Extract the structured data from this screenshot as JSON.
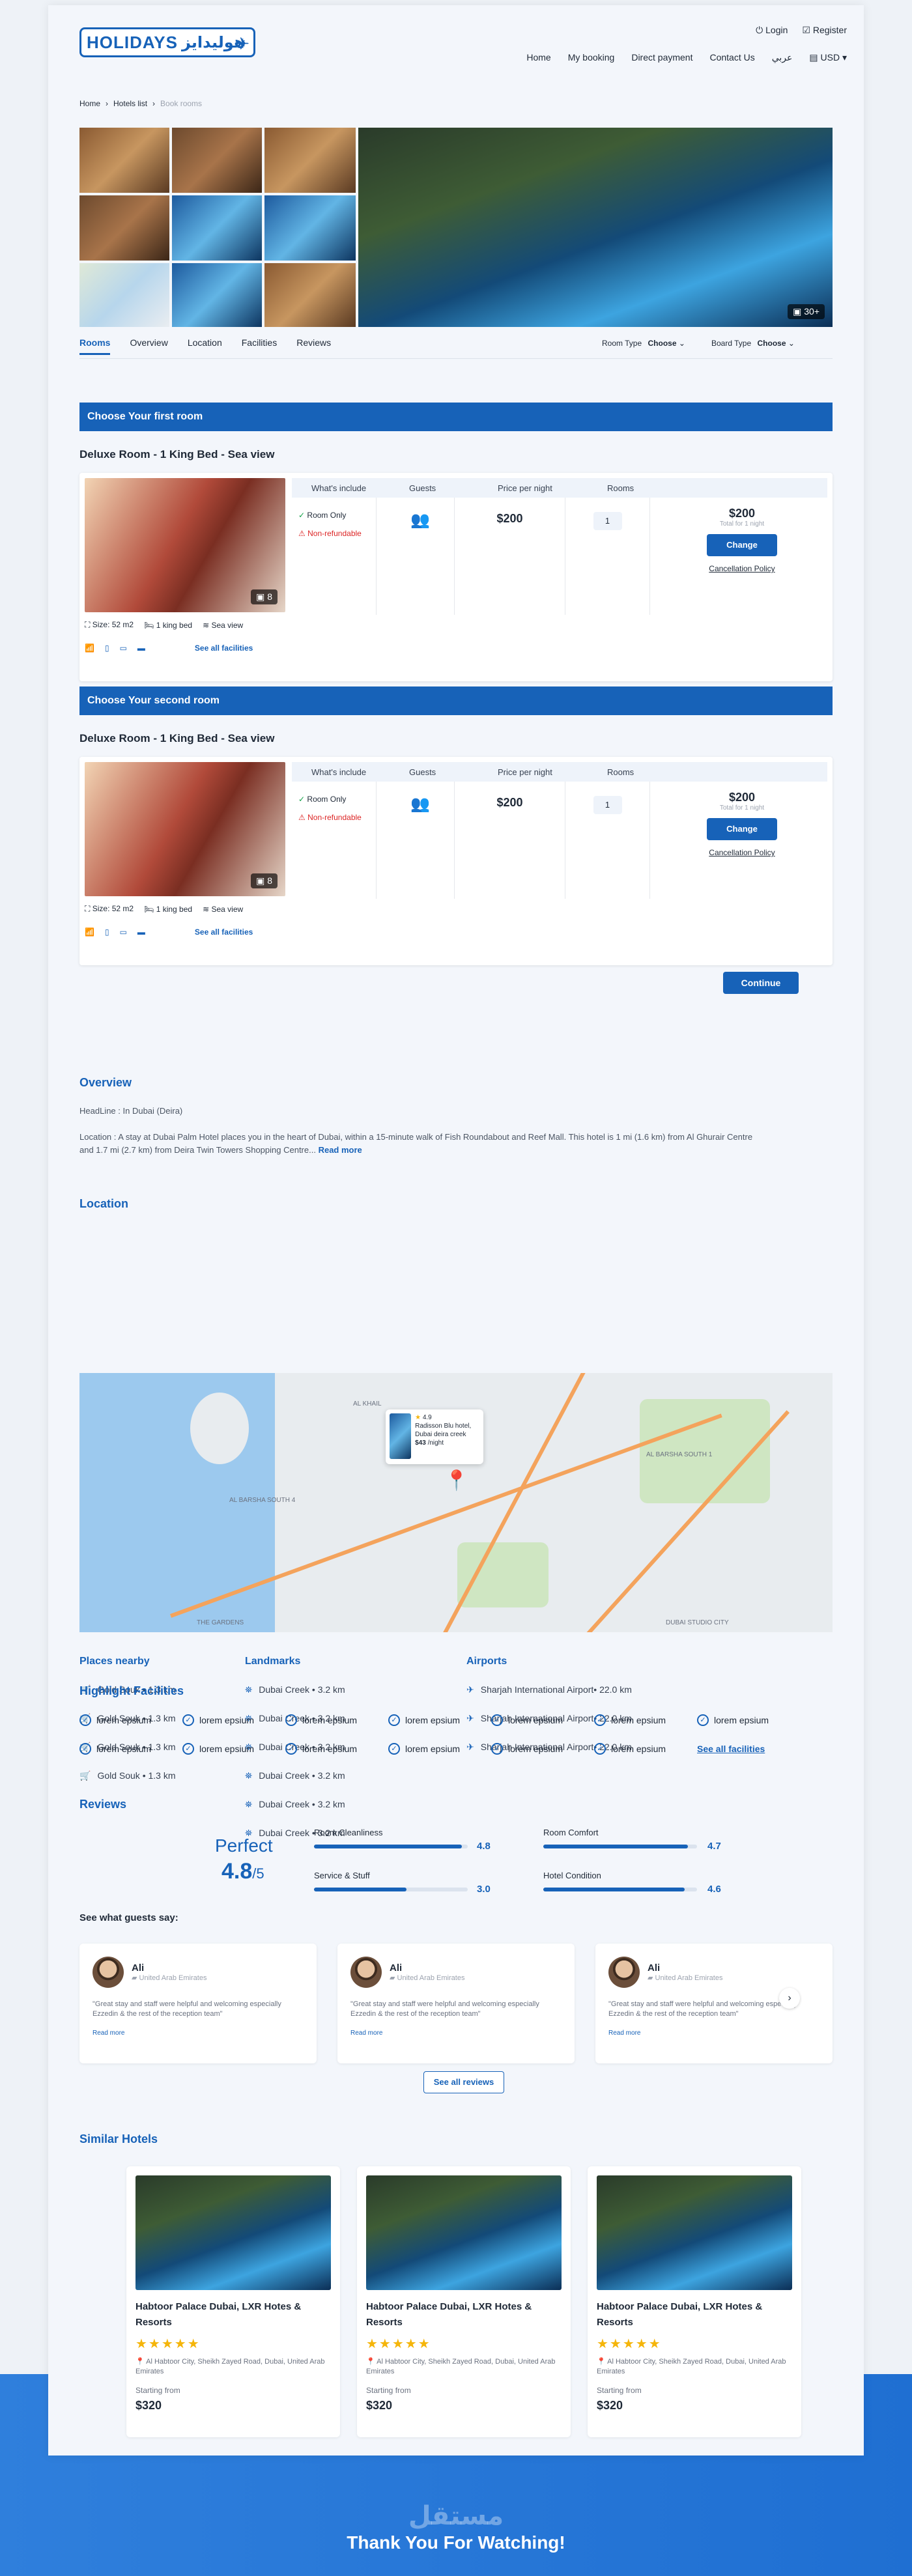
{
  "header": {
    "logo_text": "HOLIDAYS",
    "logo_arabic": "هوليدايز",
    "login": "Login",
    "register": "Register",
    "nav": [
      "Home",
      "My booking",
      "Direct payment",
      "Contact Us",
      "عربي"
    ],
    "currency": "USD"
  },
  "breadcrumb": [
    "Home",
    "Hotels list",
    "Book rooms"
  ],
  "gallery": {
    "count": "30+"
  },
  "tabs": [
    "Rooms",
    "Overview",
    "Location",
    "Facilities",
    "Reviews"
  ],
  "filters": {
    "room_type_label": "Room Type",
    "room_type_value": "Choose",
    "board_type_label": "Board Type",
    "board_type_value": "Choose"
  },
  "rooms": [
    {
      "section": "Choose Your first room",
      "title": "Deluxe Room - 1 King Bed - Sea view",
      "photos": "8",
      "headers": [
        "What's include",
        "Guests",
        "Price per night",
        "Rooms"
      ],
      "includes": [
        "Room Only",
        "Non-refundable"
      ],
      "price": "$200",
      "qty": "1",
      "total": "$200",
      "total_note": "Total for 1 night",
      "change": "Change",
      "policy": "Cancellation Policy",
      "size": "Size: 52 m2",
      "bed": "1 king bed",
      "view": "Sea view",
      "see_all": "See all facilities"
    },
    {
      "section": "Choose Your second room",
      "title": "Deluxe Room - 1 King Bed - Sea view",
      "photos": "8",
      "headers": [
        "What's include",
        "Guests",
        "Price per night",
        "Rooms"
      ],
      "includes": [
        "Room Only",
        "Non-refundable"
      ],
      "price": "$200",
      "qty": "1",
      "total": "$200",
      "total_note": "Total for 1 night",
      "change": "Change",
      "policy": "Cancellation Policy",
      "size": "Size: 52 m2",
      "bed": "1 king bed",
      "view": "Sea view",
      "see_all": "See all facilities"
    }
  ],
  "continue": "Continue",
  "overview": {
    "title": "Overview",
    "headline": "HeadLine : In Dubai (Deira)",
    "text": "Location : A stay at Dubai Palm Hotel places you in the heart of Dubai, within a 15-minute walk of Fish Roundabout and Reef Mall. This hotel is 1 mi (1.6 km) from Al Ghurair Centre and 1.7 mi (2.7 km) from Deira Twin Towers Shopping Centre...",
    "read_more": "Read more"
  },
  "location": {
    "title": "Location",
    "popup_rating": "4.9",
    "popup_name": "Radisson Blu hotel, Dubai deira creek",
    "popup_price": "$43",
    "popup_unit": "/night",
    "map_labels": [
      "AL BARSHA SOUTH 1",
      "AL KHAIL",
      "AL BARSHA SOUTH 4",
      "THE GARDENS",
      "DUBAI STUDIO CITY"
    ]
  },
  "nearby": {
    "places_title": "Places nearby",
    "places": [
      "Gold Souk • 1.3 km",
      "Gold Souk • 1.3 km",
      "Gold Souk • 1.3 km",
      "Gold Souk • 1.3 km"
    ],
    "landmarks_title": "Landmarks",
    "landmarks": [
      "Dubai Creek • 3.2 km",
      "Dubai Creek • 3.2 km",
      "Dubai Creek • 3.2 km",
      "Dubai Creek • 3.2 km",
      "Dubai Creek • 3.2 km",
      "Dubai Creek • 3.2 km"
    ],
    "airports_title": "Airports",
    "airports": [
      "Sharjah International Airport• 22.0 km",
      "Sharjah International Airport• 22.0 km",
      "Sharjah International Airport• 22.0 km"
    ]
  },
  "facilities": {
    "title": "Highlight Facilities",
    "items": [
      "lorem epsium",
      "lorem epsium",
      "lorem epsium",
      "lorem epsium",
      "lorem epsium",
      "lorem epsium",
      "lorem epsium",
      "lorem epsium",
      "lorem epsium",
      "lorem epsium",
      "lorem epsium",
      "lorem epsium",
      "lorem epsium"
    ],
    "see_all": "See all facilities"
  },
  "reviews": {
    "title": "Reviews",
    "label": "Perfect",
    "score": "4.8",
    "out_of": "/5",
    "categories": [
      {
        "name": "Room Cleanliness",
        "value": "4.8",
        "fill": 0.96
      },
      {
        "name": "Room Comfort",
        "value": "4.7",
        "fill": 0.94
      },
      {
        "name": "Service & Stuff",
        "value": "3.0",
        "fill": 0.6
      },
      {
        "name": "Hotel Condition",
        "value": "4.6",
        "fill": 0.92
      }
    ],
    "guests_title": "See what guests say:",
    "items": [
      {
        "name": "Ali",
        "country": "United Arab Emirates",
        "text": "\"Great stay and staff were helpful and welcoming especially Ezzedin & the rest of the reception team\"",
        "read": "Read more"
      },
      {
        "name": "Ali",
        "country": "United Arab Emirates",
        "text": "\"Great stay and staff were helpful and welcoming especially Ezzedin & the rest of the reception team\"",
        "read": "Read more"
      },
      {
        "name": "Ali",
        "country": "United Arab Emirates",
        "text": "\"Great stay and staff were helpful and welcoming especially Ezzedin & the rest of the reception team\"",
        "read": "Read more"
      }
    ],
    "see_all": "See all reviews"
  },
  "similar": {
    "title": "Similar Hotels",
    "items": [
      {
        "name": "Habtoor Palace Dubai, LXR Hotes & Resorts",
        "address": "Al Habtoor City, Sheikh Zayed Road, Dubai, United Arab Emirates",
        "from": "Starting from",
        "price": "$320"
      },
      {
        "name": "Habtoor Palace Dubai, LXR Hotes & Resorts",
        "address": "Al Habtoor City, Sheikh Zayed Road, Dubai, United Arab Emirates",
        "from": "Starting from",
        "price": "$320"
      },
      {
        "name": "Habtoor Palace Dubai, LXR Hotes & Resorts",
        "address": "Al Habtoor City, Sheikh Zayed Road, Dubai, United Arab Emirates",
        "from": "Starting from",
        "price": "$320"
      }
    ]
  },
  "footer": {
    "watermark": "مستقل",
    "thanks": "Thank You For Watching!"
  }
}
